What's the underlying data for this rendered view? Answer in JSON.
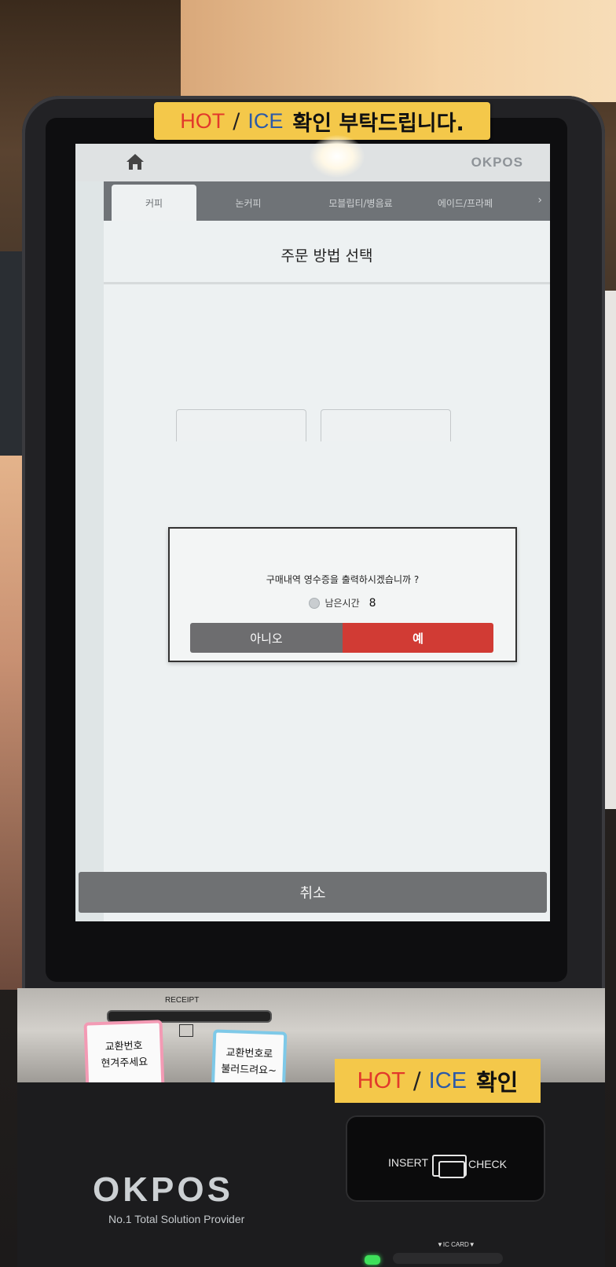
{
  "sticker_top": {
    "hot": "HOT",
    "slash": "/",
    "ice": "ICE",
    "text": "확인 부탁드립니다."
  },
  "header": {
    "brand": "OKPOS"
  },
  "tabs": [
    {
      "label": "커피",
      "active": true
    },
    {
      "label": "논커피",
      "active": false
    },
    {
      "label": "모블립티/병음료",
      "active": false
    },
    {
      "label": "에이드/프라페",
      "active": false
    }
  ],
  "main": {
    "title": "주문 방법 선택"
  },
  "dialog": {
    "question": "구매내역 영수증을 출력하시겠습니까 ?",
    "timer_label": "남은시간",
    "timer_value": "8",
    "no_label": "아니오",
    "yes_label": "예"
  },
  "cancel_label": "취소",
  "hardware": {
    "receipt_label": "RECEIPT",
    "note_pink": "교환번호\n현겨주세요",
    "note_blue": "교환번호로\n불러드려요~",
    "sticker_bottom": {
      "hot": "HOT",
      "slash": "/",
      "ice": "ICE",
      "text": "확인"
    },
    "logo": "OKPOS",
    "tagline": "No.1 Total Solution Provider",
    "card_insert": "INSERT",
    "card_check": "CHECK",
    "ic_card": "▼IC CARD▼"
  },
  "colors": {
    "accent_red": "#d13b34",
    "button_gray": "#6d6d6f",
    "sticker_yellow": "#f4c84a"
  }
}
